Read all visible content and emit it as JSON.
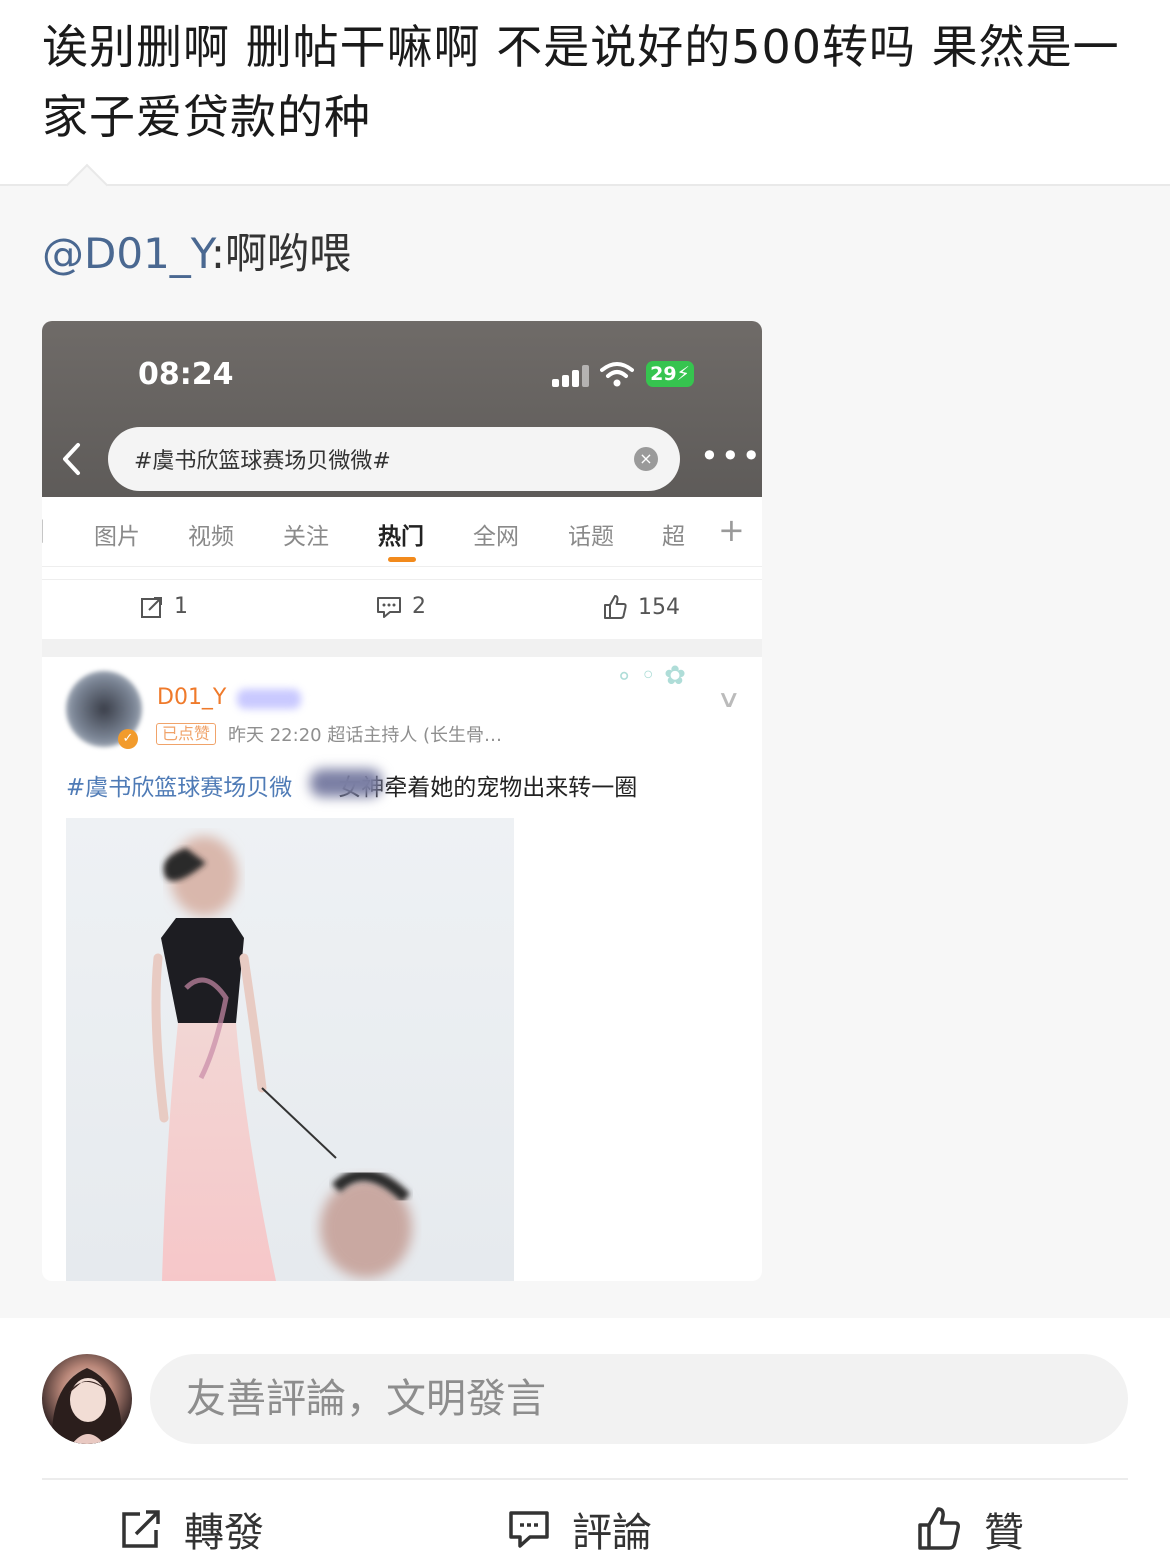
{
  "post": {
    "text": "诶别删啊 删帖干嘛啊 不是说好的500转吗 果然是一家子爱贷款的种"
  },
  "repost": {
    "mention": "@D01_Y",
    "text": ":啊哟喂"
  },
  "embedded_screenshot": {
    "status_time": "08:24",
    "battery": "29",
    "search_text": "#虞书欣篮球赛场贝微微#",
    "tabs": [
      "图片",
      "视频",
      "关注",
      "热门",
      "全网",
      "话题",
      "超"
    ],
    "active_tab": "热门",
    "actions": {
      "repost_count": "1",
      "comment_count": "2",
      "like_count": "154"
    },
    "weibo": {
      "username": "D01_Y",
      "liked_tag": "已点赞",
      "meta": "昨天 22:20  超话主持人 (长生骨…",
      "hashtag": "#虞书欣篮球赛场贝微",
      "body": "女神牵着她的宠物出来转一圈"
    }
  },
  "comment_bar": {
    "placeholder": "友善評論，文明發言"
  },
  "bottom_actions": {
    "repost_label": "轉發",
    "comment_label": "評論",
    "like_label": "贊"
  },
  "colors": {
    "mention": "#4a6891",
    "hashtag": "#4f7bb6",
    "accent_orange": "#f28a1c",
    "battery_green": "#36c44f"
  }
}
